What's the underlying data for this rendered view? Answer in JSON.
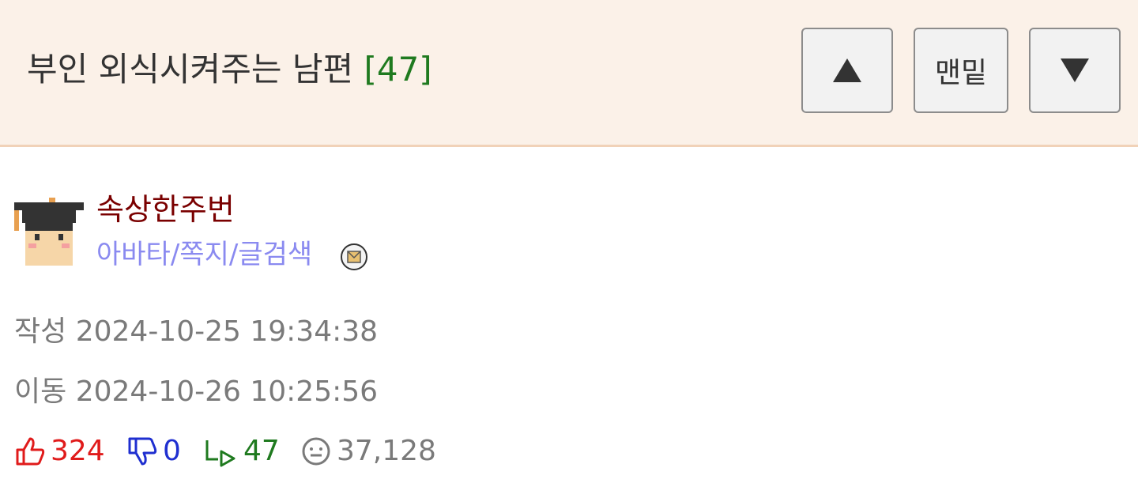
{
  "header": {
    "title": "부인 외식시켜주는 남편",
    "comment_count": "[47]",
    "buttons": {
      "up_icon": "triangle-up-icon",
      "bottom_label": "맨밑",
      "down_icon": "triangle-down-icon"
    }
  },
  "author": {
    "name": "속상한주번",
    "links": "아바타/쪽지/글검색",
    "avatar_icon": "graduate-avatar",
    "mail_icon": "envelope-icon"
  },
  "meta": {
    "created_label": "작성",
    "created": "2024-10-25 19:34:38",
    "moved_label": "이동",
    "moved": "2024-10-26 10:25:56"
  },
  "stats": {
    "upvotes": "324",
    "downvotes": "0",
    "replies": "47",
    "views": "37,128"
  },
  "colors": {
    "header_bg": "#fbf1e8",
    "author": "#7a0000",
    "links": "#8a8af0",
    "upvote": "#e01b1b",
    "downvote": "#1f2fd0",
    "reply": "#1f7a1f"
  }
}
